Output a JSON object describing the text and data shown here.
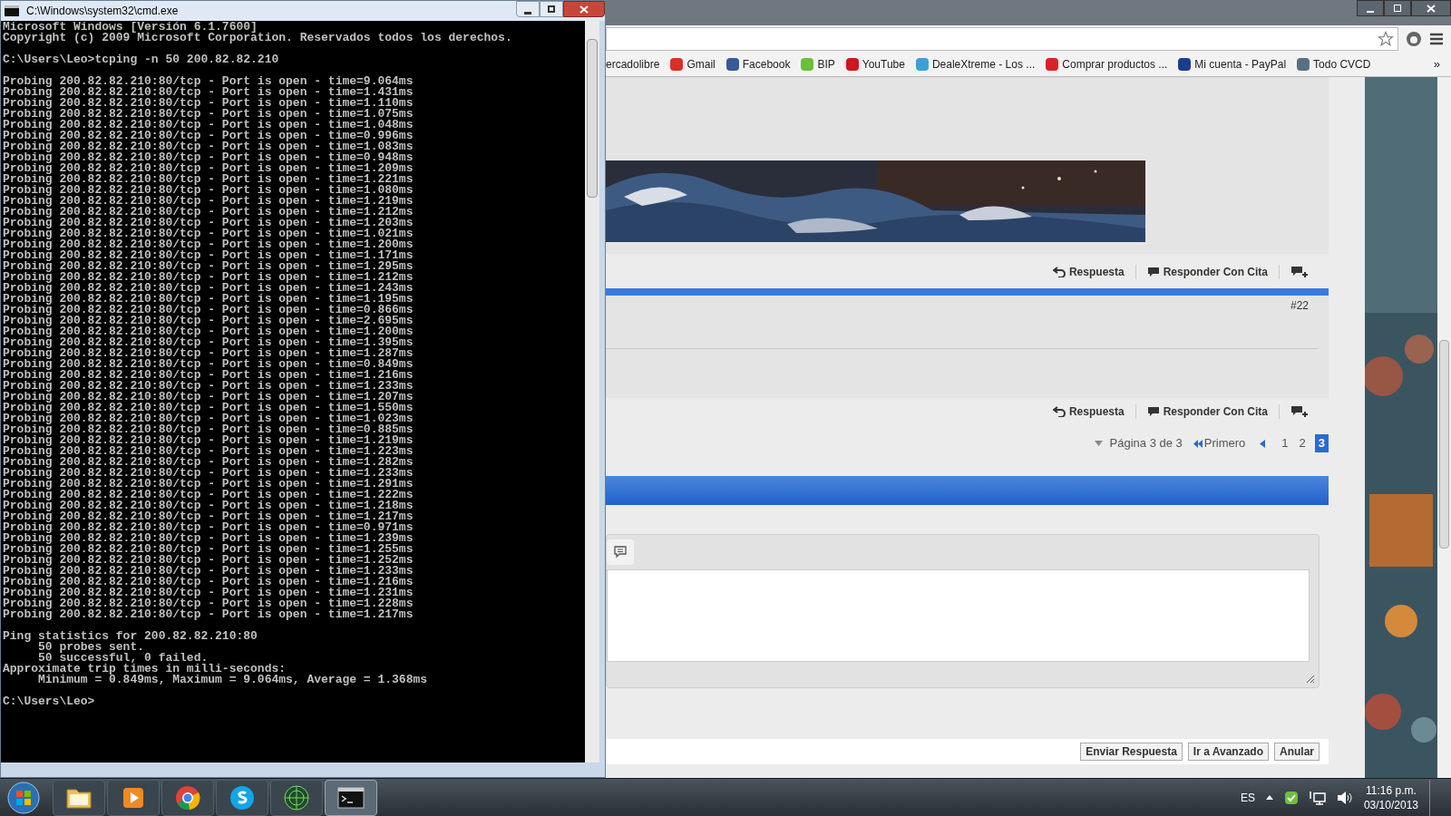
{
  "cmd": {
    "title": "C:\\Windows\\system32\\cmd.exe",
    "header": [
      "Microsoft Windows [Versión 6.1.7600]",
      "Copyright (c) 2009 Microsoft Corporation. Reservados todos los derechos."
    ],
    "command": "C:\\Users\\Leo>tcping -n 50 200.82.82.210",
    "probes": [
      "Probing 200.82.82.210:80/tcp - Port is open - time=9.064ms",
      "Probing 200.82.82.210:80/tcp - Port is open - time=1.431ms",
      "Probing 200.82.82.210:80/tcp - Port is open - time=1.110ms",
      "Probing 200.82.82.210:80/tcp - Port is open - time=1.075ms",
      "Probing 200.82.82.210:80/tcp - Port is open - time=1.048ms",
      "Probing 200.82.82.210:80/tcp - Port is open - time=0.996ms",
      "Probing 200.82.82.210:80/tcp - Port is open - time=1.083ms",
      "Probing 200.82.82.210:80/tcp - Port is open - time=0.948ms",
      "Probing 200.82.82.210:80/tcp - Port is open - time=1.209ms",
      "Probing 200.82.82.210:80/tcp - Port is open - time=1.221ms",
      "Probing 200.82.82.210:80/tcp - Port is open - time=1.080ms",
      "Probing 200.82.82.210:80/tcp - Port is open - time=1.219ms",
      "Probing 200.82.82.210:80/tcp - Port is open - time=1.212ms",
      "Probing 200.82.82.210:80/tcp - Port is open - time=1.203ms",
      "Probing 200.82.82.210:80/tcp - Port is open - time=1.021ms",
      "Probing 200.82.82.210:80/tcp - Port is open - time=1.200ms",
      "Probing 200.82.82.210:80/tcp - Port is open - time=1.171ms",
      "Probing 200.82.82.210:80/tcp - Port is open - time=1.295ms",
      "Probing 200.82.82.210:80/tcp - Port is open - time=1.212ms",
      "Probing 200.82.82.210:80/tcp - Port is open - time=1.243ms",
      "Probing 200.82.82.210:80/tcp - Port is open - time=1.195ms",
      "Probing 200.82.82.210:80/tcp - Port is open - time=0.866ms",
      "Probing 200.82.82.210:80/tcp - Port is open - time=2.695ms",
      "Probing 200.82.82.210:80/tcp - Port is open - time=1.200ms",
      "Probing 200.82.82.210:80/tcp - Port is open - time=1.395ms",
      "Probing 200.82.82.210:80/tcp - Port is open - time=1.287ms",
      "Probing 200.82.82.210:80/tcp - Port is open - time=0.849ms",
      "Probing 200.82.82.210:80/tcp - Port is open - time=1.216ms",
      "Probing 200.82.82.210:80/tcp - Port is open - time=1.233ms",
      "Probing 200.82.82.210:80/tcp - Port is open - time=1.207ms",
      "Probing 200.82.82.210:80/tcp - Port is open - time=1.550ms",
      "Probing 200.82.82.210:80/tcp - Port is open - time=1.023ms",
      "Probing 200.82.82.210:80/tcp - Port is open - time=0.885ms",
      "Probing 200.82.82.210:80/tcp - Port is open - time=1.219ms",
      "Probing 200.82.82.210:80/tcp - Port is open - time=1.223ms",
      "Probing 200.82.82.210:80/tcp - Port is open - time=1.282ms",
      "Probing 200.82.82.210:80/tcp - Port is open - time=1.233ms",
      "Probing 200.82.82.210:80/tcp - Port is open - time=1.291ms",
      "Probing 200.82.82.210:80/tcp - Port is open - time=1.222ms",
      "Probing 200.82.82.210:80/tcp - Port is open - time=1.218ms",
      "Probing 200.82.82.210:80/tcp - Port is open - time=1.217ms",
      "Probing 200.82.82.210:80/tcp - Port is open - time=0.971ms",
      "Probing 200.82.82.210:80/tcp - Port is open - time=1.239ms",
      "Probing 200.82.82.210:80/tcp - Port is open - time=1.255ms",
      "Probing 200.82.82.210:80/tcp - Port is open - time=1.252ms",
      "Probing 200.82.82.210:80/tcp - Port is open - time=1.233ms",
      "Probing 200.82.82.210:80/tcp - Port is open - time=1.216ms",
      "Probing 200.82.82.210:80/tcp - Port is open - time=1.231ms",
      "Probing 200.82.82.210:80/tcp - Port is open - time=1.228ms",
      "Probing 200.82.82.210:80/tcp - Port is open - time=1.217ms"
    ],
    "stats": [
      "Ping statistics for 200.82.82.210:80",
      "     50 probes sent.",
      "     50 successful, 0 failed.",
      "Approximate trip times in milli-seconds:",
      "     Minimum = 0.849ms, Maximum = 9.064ms, Average = 1.368ms"
    ],
    "prompt": "C:\\Users\\Leo>"
  },
  "browser": {
    "bookmarks": [
      {
        "label": "ercadolibre"
      },
      {
        "label": "Gmail",
        "color": "#d93025"
      },
      {
        "label": "Facebook",
        "color": "#3b5998"
      },
      {
        "label": "BIP",
        "color": "#6cbf3c"
      },
      {
        "label": "YouTube",
        "color": "#cc181e"
      },
      {
        "label": "DealeXtreme - Los ...",
        "color": "#3aa0d8"
      },
      {
        "label": "Comprar productos ...",
        "color": "#d8232a"
      },
      {
        "label": "Mi cuenta - PayPal",
        "color": "#1a3d8f"
      },
      {
        "label": "Todo CVCD",
        "color": "#5a7080"
      }
    ],
    "bookmarks_overflow": "»",
    "page": {
      "action_rows": [
        {
          "reply": "Respuesta",
          "quote": "Responder Con Cita"
        },
        {
          "reply": "Respuesta",
          "quote": "Responder Con Cita"
        }
      ],
      "post_number": "#22",
      "pagination": {
        "summary": "Página 3 de 3",
        "first": "Primero",
        "pages": [
          {
            "label": "1",
            "selected": false
          },
          {
            "label": "2",
            "selected": false
          },
          {
            "label": "3",
            "selected": true
          }
        ]
      },
      "buttons": [
        "Enviar Respuesta",
        "Ir a Avanzado",
        "Anular"
      ]
    }
  },
  "taskbar": {
    "apps": [
      {
        "kind": "folder",
        "selected": false
      },
      {
        "kind": "media",
        "selected": false
      },
      {
        "kind": "browser",
        "selected": false
      },
      {
        "kind": "chat",
        "selected": false
      },
      {
        "kind": "radar",
        "selected": false
      },
      {
        "kind": "terminal",
        "selected": true
      }
    ],
    "language": "ES",
    "time": "11:16 p.m.",
    "date": "03/10/2013"
  }
}
